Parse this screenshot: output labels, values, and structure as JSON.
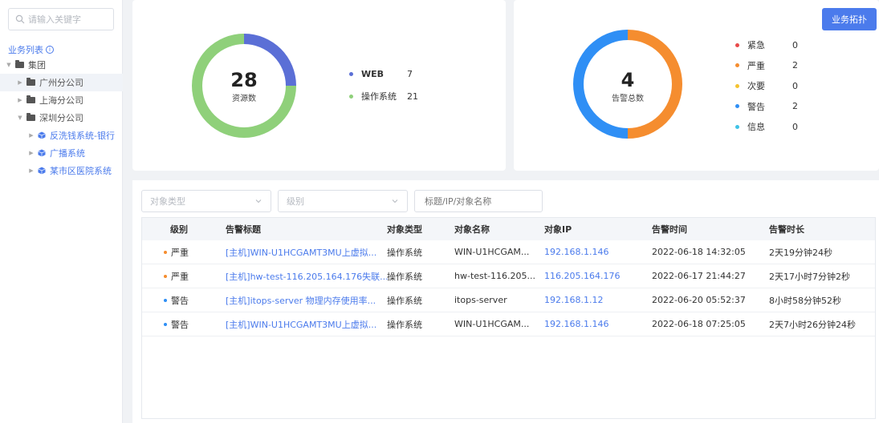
{
  "sidebar": {
    "search_placeholder": "请输入关键字",
    "list_title": "业务列表",
    "tree": [
      {
        "label": "集团"
      },
      {
        "label": "广州分公司"
      },
      {
        "label": "上海分公司"
      },
      {
        "label": "深圳分公司"
      },
      {
        "label": "反洗钱系统-银行"
      },
      {
        "label": "广播系统"
      },
      {
        "label": "某市区医院系统"
      }
    ]
  },
  "resources": {
    "total": "28",
    "label": "资源数",
    "items": [
      {
        "name": "WEB",
        "value": "7",
        "color": "#5b6fd6"
      },
      {
        "name": "操作系统",
        "value": "21",
        "color": "#8fd07a"
      }
    ]
  },
  "alerts": {
    "total": "4",
    "label": "告警总数",
    "items": [
      {
        "name": "紧急",
        "value": "0",
        "color": "#e84a4a"
      },
      {
        "name": "严重",
        "value": "2",
        "color": "#f58d2f"
      },
      {
        "name": "次要",
        "value": "0",
        "color": "#f5c32f"
      },
      {
        "name": "警告",
        "value": "2",
        "color": "#2f8ff5"
      },
      {
        "name": "信息",
        "value": "0",
        "color": "#3fc2e6"
      }
    ]
  },
  "topo_button": "业务拓扑",
  "filters": {
    "type_placeholder": "对象类型",
    "level_placeholder": "级别",
    "search_placeholder": "标题/IP/对象名称"
  },
  "table": {
    "headers": [
      "级别",
      "告警标题",
      "对象类型",
      "对象名称",
      "对象IP",
      "告警时间",
      "告警时长"
    ],
    "rows": [
      {
        "level": "严重",
        "level_color": "#f58d2f",
        "title": "[主机]WIN-U1HCGAMT3MU上虚拟...",
        "type": "操作系统",
        "name": "WIN-U1HCGAM...",
        "ip": "192.168.1.146",
        "time": "2022-06-18 14:32:05",
        "duration": "2天19分钟24秒"
      },
      {
        "level": "严重",
        "level_color": "#f58d2f",
        "title": "[主机]hw-test-116.205.164.176失联...",
        "type": "操作系统",
        "name": "hw-test-116.205...",
        "ip": "116.205.164.176",
        "time": "2022-06-17 21:44:27",
        "duration": "2天17小时7分钟2秒"
      },
      {
        "level": "警告",
        "level_color": "#2f8ff5",
        "title": "[主机]itops-server 物理内存使用率...",
        "type": "操作系统",
        "name": "itops-server",
        "ip": "192.168.1.12",
        "time": "2022-06-20 05:52:37",
        "duration": "8小时58分钟52秒"
      },
      {
        "level": "警告",
        "level_color": "#2f8ff5",
        "title": "[主机]WIN-U1HCGAMT3MU上虚拟...",
        "type": "操作系统",
        "name": "WIN-U1HCGAM...",
        "ip": "192.168.1.146",
        "time": "2022-06-18 07:25:05",
        "duration": "2天7小时26分钟24秒"
      }
    ]
  }
}
